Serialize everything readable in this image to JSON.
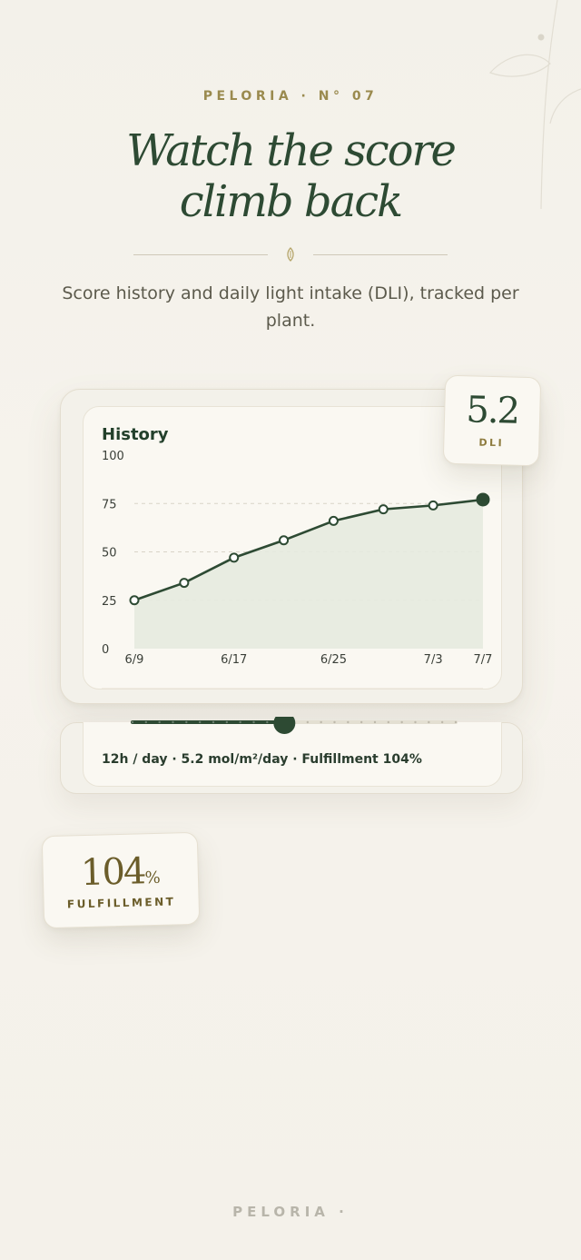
{
  "header": {
    "eyebrow": "PELORIA · N° 07",
    "title_line1": "Watch the score",
    "title_line2": "climb back",
    "subtitle": "Score history and daily light intake (DLI), tracked per plant."
  },
  "card": {
    "title": "History",
    "slider_info": "12h / day · 5.2 mol/m²/day · Fulfillment 104%",
    "slider_value": 0.47
  },
  "badges": {
    "dli_value": "5.2",
    "dli_label": "DLI",
    "fulfillment_value": "104",
    "fulfillment_unit": "%",
    "fulfillment_label": "FULFILLMENT"
  },
  "footer": {
    "brand": "PELORIA ·"
  },
  "colors": {
    "accent": "#2d4a33",
    "gold": "#9a8a4e",
    "area": "#e6eadf"
  },
  "chart_data": {
    "type": "line",
    "title": "History",
    "xlabel": "",
    "ylabel": "",
    "ylim": [
      0,
      100
    ],
    "yticks": [
      0,
      25,
      50,
      75,
      100
    ],
    "xtick_labels": [
      "6/9",
      "6/17",
      "6/25",
      "7/3",
      "7/7"
    ],
    "x_days": [
      0,
      4,
      8,
      12,
      16,
      20,
      24,
      28
    ],
    "values": [
      25,
      34,
      47,
      56,
      66,
      72,
      74,
      77
    ],
    "grid": true
  }
}
